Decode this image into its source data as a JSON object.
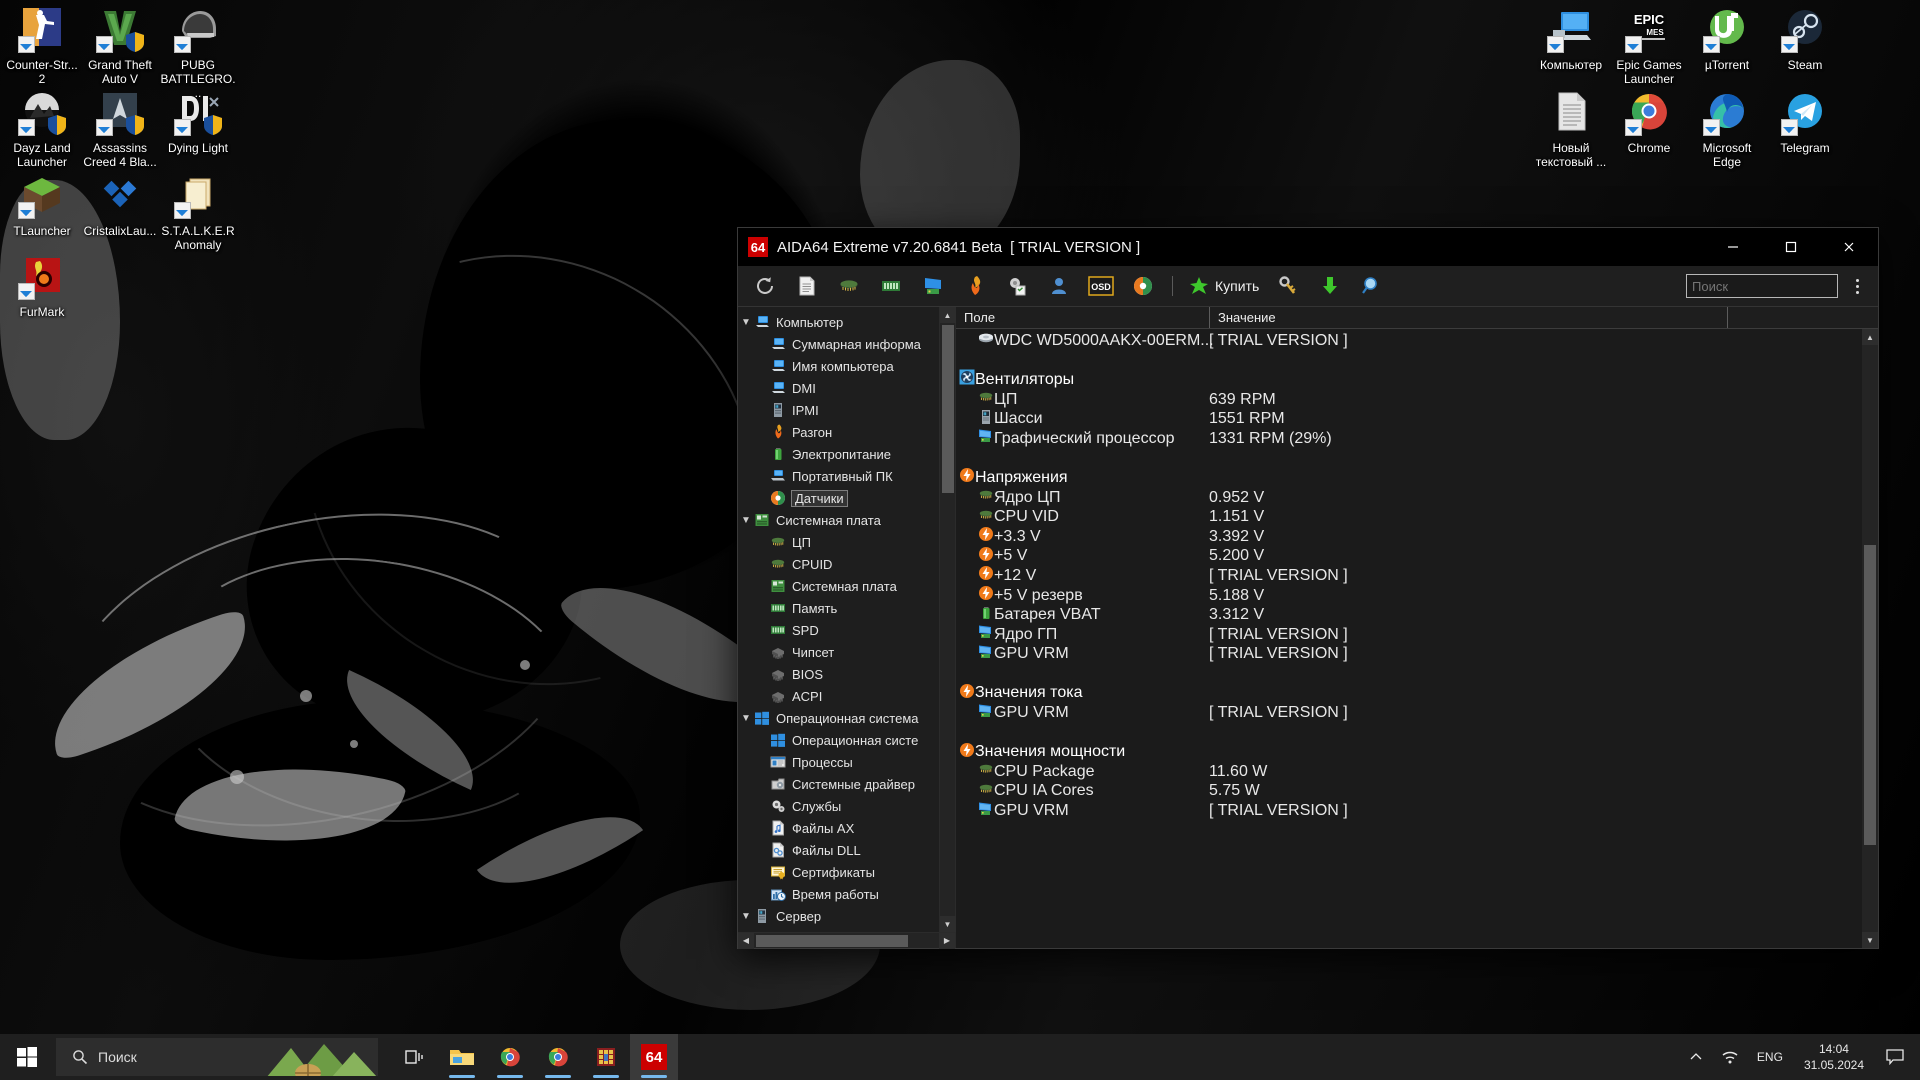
{
  "desktop": {
    "icons_left": [
      {
        "label": "Counter-Str... 2",
        "icon": "counter-strike-icon"
      },
      {
        "label": "Grand Theft Auto V",
        "icon": "gta-v-icon"
      },
      {
        "label": "PUBG BATTLEGRO...",
        "icon": "pubg-icon"
      },
      {
        "label": "Dayz Land Launcher",
        "icon": "dayz-icon"
      },
      {
        "label": "Assassins Creed 4 Bla...",
        "icon": "assassins-creed-icon"
      },
      {
        "label": "Dying Light",
        "icon": "dying-light-icon"
      },
      {
        "label": "TLauncher",
        "icon": "tlauncher-icon"
      },
      {
        "label": "CristalixLau...",
        "icon": "cristalix-icon"
      },
      {
        "label": "S.T.A.L.K.E.R Anomaly",
        "icon": "stalker-icon"
      },
      {
        "label": "FurMark",
        "icon": "furmark-icon"
      }
    ],
    "icons_right": [
      {
        "label": "Компьютер",
        "icon": "computer-icon"
      },
      {
        "label": "Epic Games Launcher",
        "icon": "epic-games-icon"
      },
      {
        "label": "µTorrent",
        "icon": "utorrent-icon"
      },
      {
        "label": "Steam",
        "icon": "steam-icon"
      },
      {
        "label": "Новый текстовый ...",
        "icon": "text-file-icon"
      },
      {
        "label": "Chrome",
        "icon": "chrome-icon"
      },
      {
        "label": "Microsoft Edge",
        "icon": "edge-icon"
      },
      {
        "label": "Telegram",
        "icon": "telegram-icon"
      }
    ]
  },
  "window": {
    "badge": "64",
    "title": "AIDA64 Extreme v7.20.6841 Beta",
    "trial": "[ TRIAL VERSION ]",
    "minimize": "—",
    "maximize": "☐",
    "close": "✕"
  },
  "toolbar": {
    "buttons": [
      {
        "name": "refresh-icon",
        "tooltip": "Обновить"
      },
      {
        "name": "report-icon",
        "tooltip": "Отчёт"
      },
      {
        "name": "cpu-icon",
        "tooltip": "ЦП"
      },
      {
        "name": "memory-icon",
        "tooltip": "Память"
      },
      {
        "name": "display-icon",
        "tooltip": "Монитор"
      },
      {
        "name": "benchmark-fire-icon",
        "tooltip": "Тест стабильности"
      },
      {
        "name": "preferences-icon",
        "tooltip": "Настройки"
      },
      {
        "name": "user-icon",
        "tooltip": "Пользователь"
      },
      {
        "name": "osd-icon",
        "tooltip": "OSD"
      },
      {
        "name": "sensor-icon",
        "tooltip": "Датчики"
      }
    ],
    "buy_label": "Купить",
    "buttons_right": [
      {
        "name": "key-icon",
        "tooltip": "Лицензия"
      },
      {
        "name": "download-icon",
        "tooltip": "Загрузить"
      },
      {
        "name": "search-magnifier-icon",
        "tooltip": "Поиск"
      }
    ],
    "search_placeholder": "Поиск"
  },
  "tree": [
    {
      "label": "Компьютер",
      "level": 0,
      "expanded": true,
      "icon": "computer-icon"
    },
    {
      "label": "Суммарная информа",
      "level": 1,
      "icon": "computer-icon"
    },
    {
      "label": "Имя компьютера",
      "level": 1,
      "icon": "computer-icon"
    },
    {
      "label": "DMI",
      "level": 1,
      "icon": "computer-icon"
    },
    {
      "label": "IPMI",
      "level": 1,
      "icon": "server-icon"
    },
    {
      "label": "Разгон",
      "level": 1,
      "icon": "fire-icon"
    },
    {
      "label": "Электропитание",
      "level": 1,
      "icon": "battery-icon"
    },
    {
      "label": "Портативный ПК",
      "level": 1,
      "icon": "laptop-icon"
    },
    {
      "label": "Датчики",
      "level": 1,
      "icon": "sensor-icon",
      "selected": true
    },
    {
      "label": "Системная плата",
      "level": 0,
      "expanded": true,
      "icon": "motherboard-icon"
    },
    {
      "label": "ЦП",
      "level": 1,
      "icon": "cpu-icon"
    },
    {
      "label": "CPUID",
      "level": 1,
      "icon": "cpu-icon"
    },
    {
      "label": "Системная плата",
      "level": 1,
      "icon": "motherboard-icon"
    },
    {
      "label": "Память",
      "level": 1,
      "icon": "memory-icon"
    },
    {
      "label": "SPD",
      "level": 1,
      "icon": "memory-icon"
    },
    {
      "label": "Чипсет",
      "level": 1,
      "icon": "chipset-icon"
    },
    {
      "label": "BIOS",
      "level": 1,
      "icon": "chipset-icon"
    },
    {
      "label": "ACPI",
      "level": 1,
      "icon": "chipset-icon"
    },
    {
      "label": "Операционная система",
      "level": 0,
      "expanded": true,
      "icon": "windows-icon"
    },
    {
      "label": "Операционная систе",
      "level": 1,
      "icon": "windows-icon"
    },
    {
      "label": "Процессы",
      "level": 1,
      "icon": "process-icon"
    },
    {
      "label": "Системные драйвер",
      "level": 1,
      "icon": "driver-icon"
    },
    {
      "label": "Службы",
      "level": 1,
      "icon": "services-icon"
    },
    {
      "label": "Файлы AX",
      "level": 1,
      "icon": "ax-file-icon"
    },
    {
      "label": "Файлы DLL",
      "level": 1,
      "icon": "dll-file-icon"
    },
    {
      "label": "Сертификаты",
      "level": 1,
      "icon": "certificate-icon"
    },
    {
      "label": "Время работы",
      "level": 1,
      "icon": "uptime-icon"
    },
    {
      "label": "Сервер",
      "level": 0,
      "expanded": true,
      "icon": "server-icon"
    }
  ],
  "list": {
    "headers": {
      "field": "Поле",
      "value": "Значение"
    },
    "rows": [
      {
        "type": "item",
        "icon": "hdd-icon",
        "name": "WDC WD5000AAKX-00ERM...",
        "value": "[ TRIAL VERSION ]"
      },
      {
        "type": "spacer"
      },
      {
        "type": "group",
        "icon": "fan-icon",
        "name": "Вентиляторы",
        "value": ""
      },
      {
        "type": "item",
        "icon": "cpu-icon",
        "name": "ЦП",
        "value": "639 RPM"
      },
      {
        "type": "item",
        "icon": "chassis-icon",
        "name": "Шасси",
        "value": "1551 RPM"
      },
      {
        "type": "item",
        "icon": "gpu-icon",
        "name": "Графический процессор",
        "value": "1331 RPM  (29%)"
      },
      {
        "type": "spacer"
      },
      {
        "type": "group",
        "icon": "voltage-icon",
        "name": "Напряжения",
        "value": ""
      },
      {
        "type": "item",
        "icon": "cpu-icon",
        "name": "Ядро ЦП",
        "value": "0.952 V"
      },
      {
        "type": "item",
        "icon": "cpu-icon",
        "name": "CPU VID",
        "value": "1.151 V"
      },
      {
        "type": "item",
        "icon": "voltage-icon",
        "name": "+3.3 V",
        "value": "3.392 V"
      },
      {
        "type": "item",
        "icon": "voltage-icon",
        "name": "+5 V",
        "value": "5.200 V"
      },
      {
        "type": "item",
        "icon": "voltage-icon",
        "name": "+12 V",
        "value": "[ TRIAL VERSION ]"
      },
      {
        "type": "item",
        "icon": "voltage-icon",
        "name": "+5 V резерв",
        "value": "5.188 V"
      },
      {
        "type": "item",
        "icon": "battery-icon",
        "name": "Батарея VBAT",
        "value": "3.312 V"
      },
      {
        "type": "item",
        "icon": "gpu-icon",
        "name": "Ядро ГП",
        "value": "[ TRIAL VERSION ]"
      },
      {
        "type": "item",
        "icon": "gpu-icon",
        "name": "GPU VRM",
        "value": "[ TRIAL VERSION ]"
      },
      {
        "type": "spacer"
      },
      {
        "type": "group",
        "icon": "voltage-icon",
        "name": "Значения тока",
        "value": ""
      },
      {
        "type": "item",
        "icon": "gpu-icon",
        "name": "GPU VRM",
        "value": "[ TRIAL VERSION ]"
      },
      {
        "type": "spacer"
      },
      {
        "type": "group",
        "icon": "voltage-icon",
        "name": "Значения мощности",
        "value": ""
      },
      {
        "type": "item",
        "icon": "cpu-icon",
        "name": "CPU Package",
        "value": "11.60 W"
      },
      {
        "type": "item",
        "icon": "cpu-icon",
        "name": "CPU IA Cores",
        "value": "5.75 W"
      },
      {
        "type": "item",
        "icon": "gpu-icon",
        "name": "GPU VRM",
        "value": "[ TRIAL VERSION ]"
      }
    ]
  },
  "taskbar": {
    "search_placeholder": "Поиск",
    "icons": [
      {
        "name": "task-view-icon"
      },
      {
        "name": "file-explorer-icon"
      },
      {
        "name": "chrome-icon"
      },
      {
        "name": "chrome-icon-2"
      },
      {
        "name": "winrar-icon"
      },
      {
        "name": "aida64-icon",
        "label": "64",
        "active": true
      }
    ],
    "tray": {
      "chevron": "∧",
      "network": "network-icon",
      "language": "ENG",
      "time": "14:04",
      "date": "31.05.2024",
      "action_center": "action-center-icon"
    }
  },
  "colors": {
    "accent": "#cc0000",
    "window_bg": "#1e1e1e",
    "titlebar_bg": "#000000",
    "text": "#e8e8e8",
    "taskbar_bg": "#1f1f1f"
  }
}
